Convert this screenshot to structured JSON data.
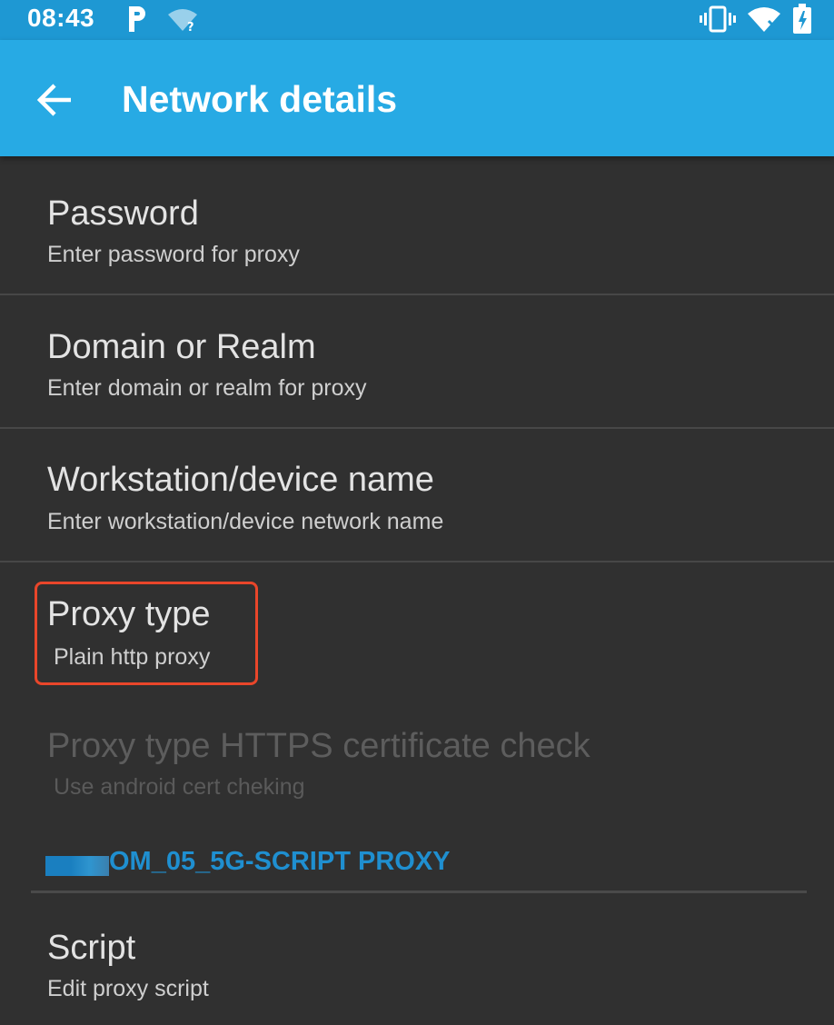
{
  "status_bar": {
    "time": "08:43",
    "icons": [
      "parking-app-icon",
      "wifi-question-icon",
      "vibrate-icon",
      "wifi-x-icon",
      "battery-icon"
    ]
  },
  "app_bar": {
    "title": "Network details",
    "back_icon": "arrow-back-icon"
  },
  "preferences": [
    {
      "title": "Password",
      "summary": "Enter password for proxy",
      "enabled": true
    },
    {
      "title": "Domain or Realm",
      "summary": "Enter domain or realm for proxy",
      "enabled": true
    },
    {
      "title": "Workstation/device name",
      "summary": "Enter workstation/device network name",
      "enabled": true
    },
    {
      "title": "Proxy type",
      "summary": "Plain http proxy",
      "enabled": true,
      "highlighted": true
    },
    {
      "title": "Proxy type HTTPS certificate check",
      "summary": "Use android cert cheking",
      "enabled": false
    }
  ],
  "category": {
    "label": "OM_05_5G-SCRIPT PROXY"
  },
  "script_item": {
    "title": "Script",
    "summary": "Edit proxy script"
  },
  "colors": {
    "status_bar": "#1e98d3",
    "app_bar": "#27aae4",
    "background": "#303030",
    "accent": "#1f8fd0",
    "highlight": "#e9462a"
  }
}
